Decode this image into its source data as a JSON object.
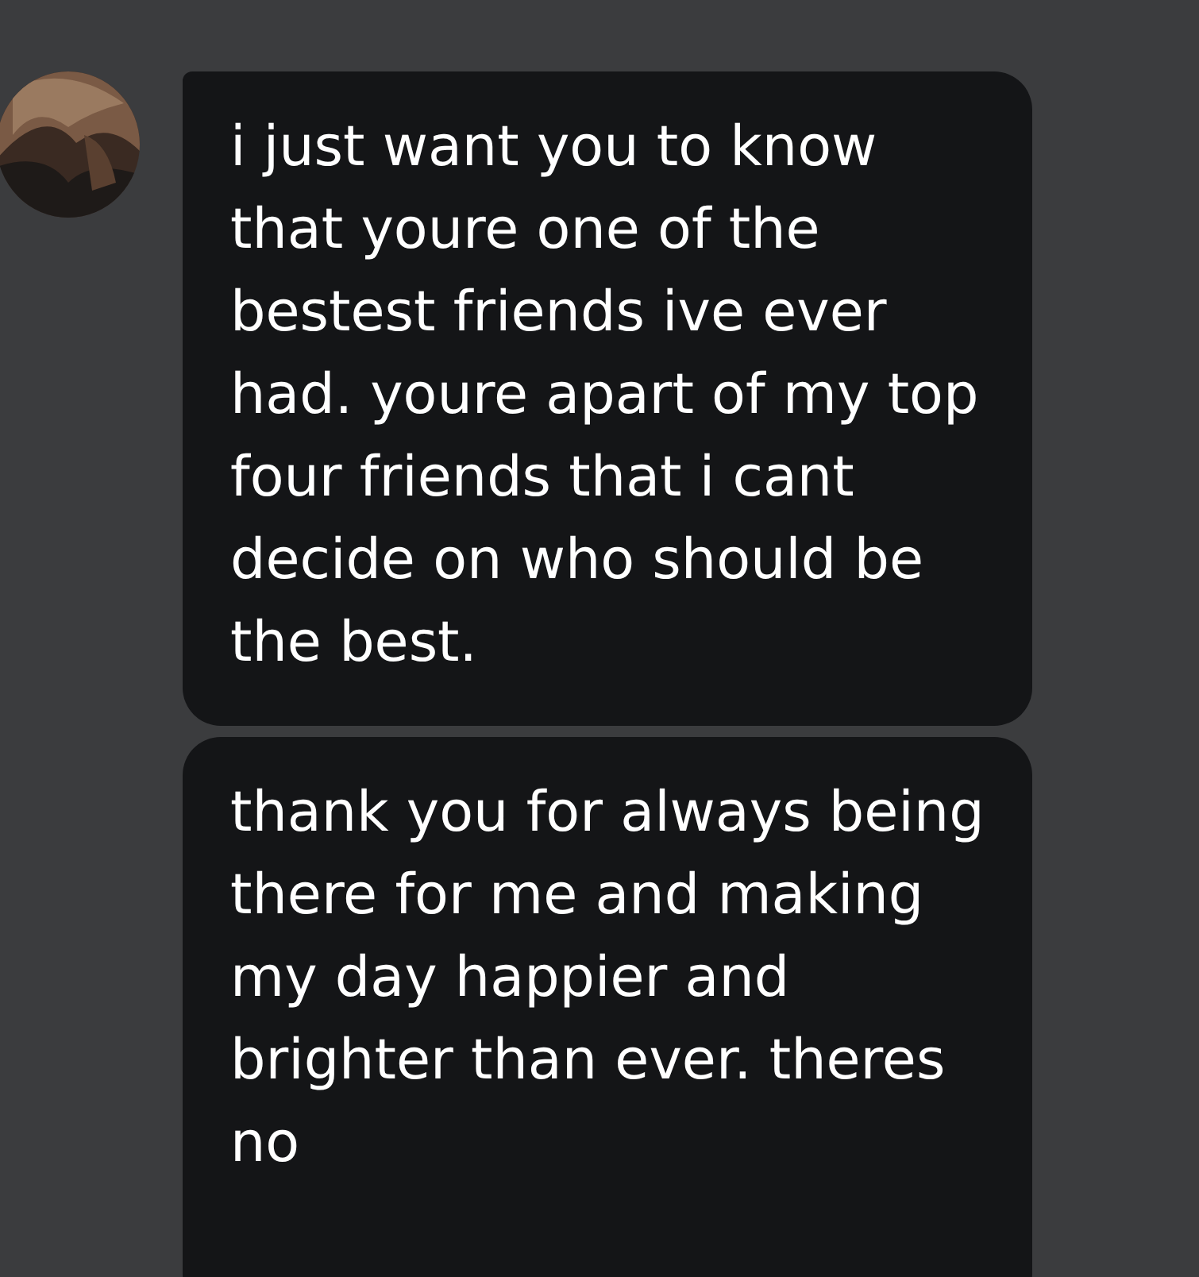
{
  "messages": [
    {
      "text": "i just want you to know that youre one of the bestest friends ive ever had. youre apart of my top four friends that i cant decide on who should be the best."
    },
    {
      "text": "thank you for always being there for me and making my day happier and brighter than ever. theres no"
    }
  ]
}
